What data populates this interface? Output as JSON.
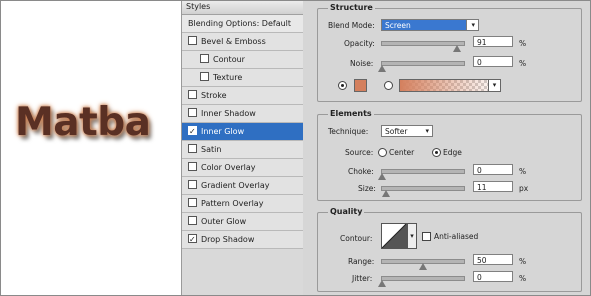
{
  "preview": {
    "text": "Matba"
  },
  "styles_panel": {
    "header": "Styles",
    "blending_label": "Blending Options: Default",
    "items": [
      {
        "label": "Bevel & Emboss",
        "checked": false,
        "indent": false,
        "selected": false
      },
      {
        "label": "Contour",
        "checked": false,
        "indent": true,
        "selected": false
      },
      {
        "label": "Texture",
        "checked": false,
        "indent": true,
        "selected": false
      },
      {
        "label": "Stroke",
        "checked": false,
        "indent": false,
        "selected": false
      },
      {
        "label": "Inner Shadow",
        "checked": false,
        "indent": false,
        "selected": false
      },
      {
        "label": "Inner Glow",
        "checked": true,
        "indent": false,
        "selected": true
      },
      {
        "label": "Satin",
        "checked": false,
        "indent": false,
        "selected": false
      },
      {
        "label": "Color Overlay",
        "checked": false,
        "indent": false,
        "selected": false
      },
      {
        "label": "Gradient Overlay",
        "checked": false,
        "indent": false,
        "selected": false
      },
      {
        "label": "Pattern Overlay",
        "checked": false,
        "indent": false,
        "selected": false
      },
      {
        "label": "Outer Glow",
        "checked": false,
        "indent": false,
        "selected": false
      },
      {
        "label": "Drop Shadow",
        "checked": true,
        "indent": false,
        "selected": false
      }
    ]
  },
  "structure": {
    "title": "Structure",
    "blend_mode_label": "Blend Mode:",
    "blend_mode_value": "Screen",
    "opacity_label": "Opacity:",
    "opacity_value": "91",
    "opacity_unit": "%",
    "opacity_level": 0.91,
    "noise_label": "Noise:",
    "noise_value": "0",
    "noise_unit": "%",
    "noise_level": 0,
    "glow_color": "#d4805e"
  },
  "elements": {
    "title": "Elements",
    "technique_label": "Technique:",
    "technique_value": "Softer",
    "source_label": "Source:",
    "source_center": "Center",
    "source_edge": "Edge",
    "source_selected": "Edge",
    "choke_label": "Choke:",
    "choke_value": "0",
    "choke_unit": "%",
    "choke_level": 0,
    "size_label": "Size:",
    "size_value": "11",
    "size_unit": "px",
    "size_level": 0.045
  },
  "quality": {
    "title": "Quality",
    "contour_label": "Contour:",
    "anti_aliased_label": "Anti-aliased",
    "anti_aliased_checked": false,
    "range_label": "Range:",
    "range_value": "50",
    "range_unit": "%",
    "range_level": 0.5,
    "jitter_label": "Jitter:",
    "jitter_value": "0",
    "jitter_unit": "%",
    "jitter_level": 0
  }
}
